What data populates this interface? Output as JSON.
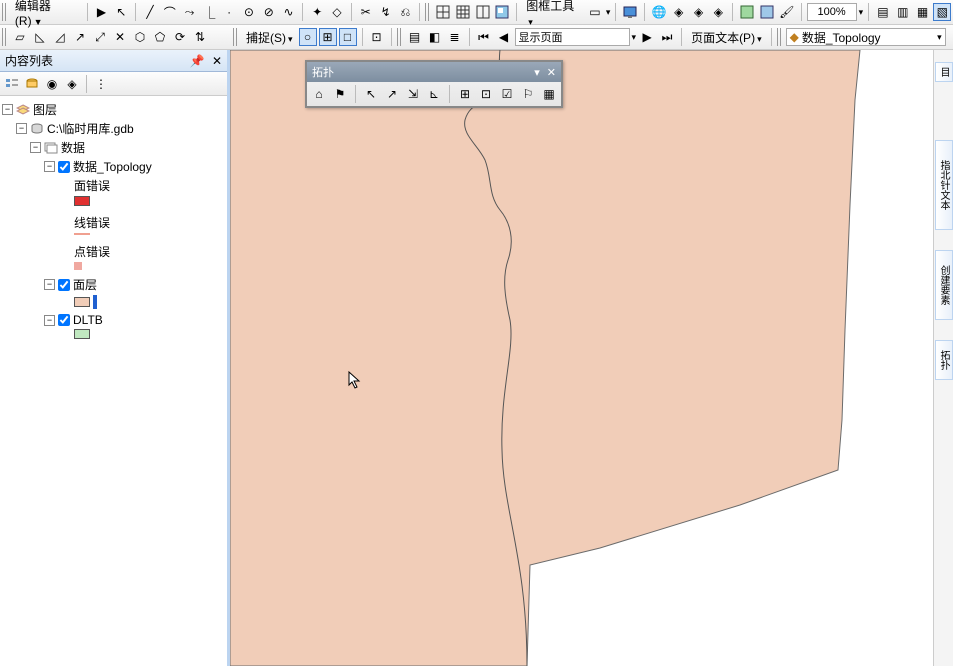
{
  "toolbars": {
    "row1": {
      "editor_menu": "编辑器(R)",
      "frame_tools": "图框工具",
      "zoom": "100%"
    },
    "row2": {
      "snap_label": "捕捉(S)",
      "page_display": "显示页面",
      "page_text": "页面文本(P)",
      "topology_select": "数据_Topology"
    }
  },
  "toc": {
    "title": "内容列表",
    "root": "图层",
    "gdb": "C:\\临时用库.gdb",
    "dataset": "数据",
    "topology": "数据_Topology",
    "errors": {
      "area": "面错误",
      "line": "线错误",
      "point": "点错误"
    },
    "layer_face": "面层",
    "layer_dltb": "DLTB"
  },
  "floating": {
    "title": "拓扑"
  },
  "right_tabs": [
    "目",
    "指北针文本",
    "创建要素",
    "拓扑"
  ],
  "colors": {
    "map_fill": "#f1cdb8",
    "err_area": "#e03030",
    "err_line": "#f0a090",
    "err_point": "#f0a8a0",
    "face_fill": "#f1cdb8",
    "face_border": "#2060d0",
    "dltb_fill": "#c0e8c0"
  }
}
